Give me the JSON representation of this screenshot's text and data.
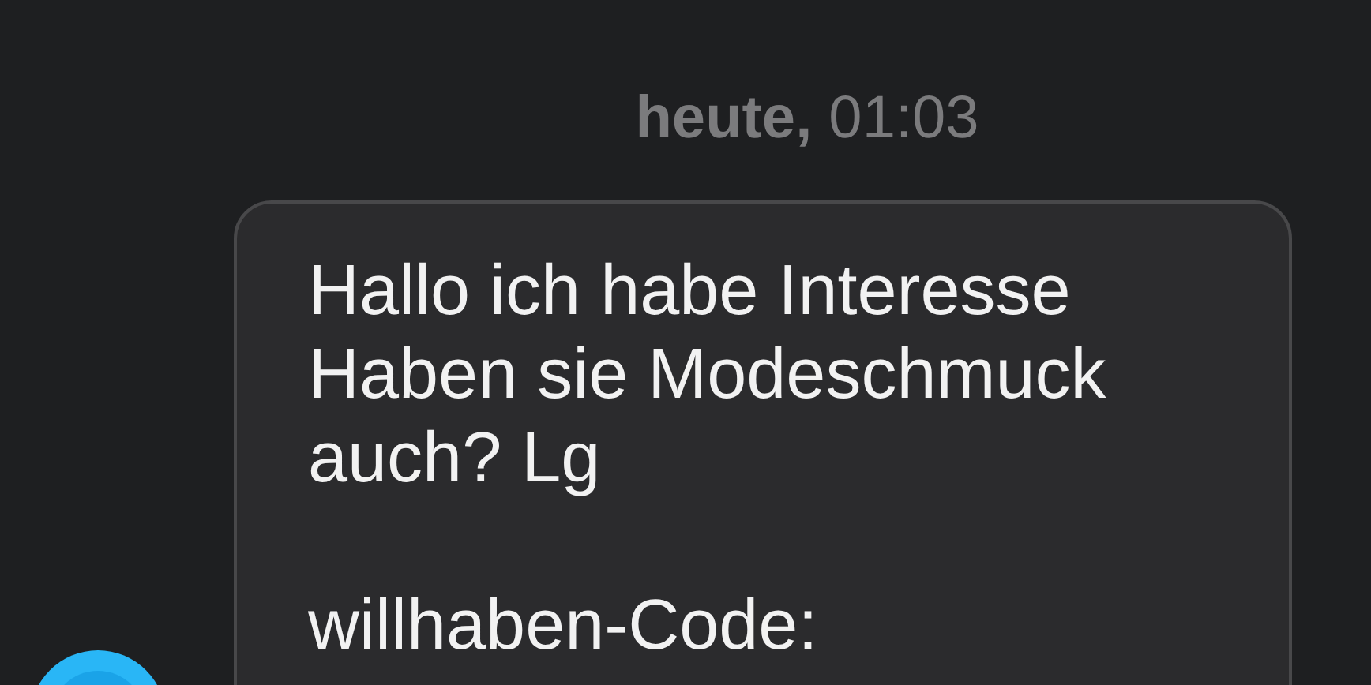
{
  "timestamp": "**heute,** 01:03",
  "message": {
    "text": "Hallo ich habe Interesse\nHaben sie Modeschmuck\nauch? Lg",
    "code_label": "willhaben-Code:"
  }
}
